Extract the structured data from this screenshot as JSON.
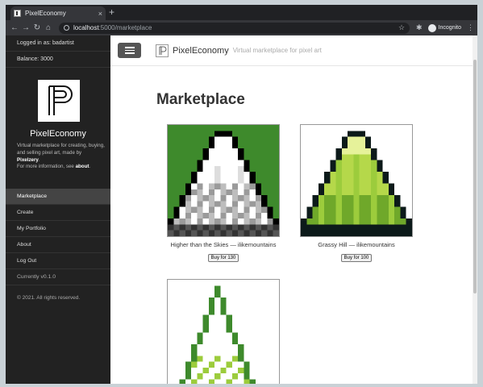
{
  "browser": {
    "tab_title": "PixelEconomy",
    "tab_close": "×",
    "new_tab": "+",
    "url_host": "localhost",
    "url_path": ":5000/marketplace",
    "incognito_label": "Incognito"
  },
  "sidebar": {
    "logged_in": "Logged in as: badartist",
    "balance": "Balance: 3000",
    "brand": "PixelEconomy",
    "desc_1": "Virtual marketplace for creating, buying, and selling pixel art, made by ",
    "desc_author": "Pixelzery",
    "desc_2": ".",
    "desc_more": "For more information, see ",
    "desc_about": "about",
    "desc_end": ".",
    "nav": [
      {
        "label": "Marketplace",
        "active": true
      },
      {
        "label": "Create"
      },
      {
        "label": "My Portfolio"
      },
      {
        "label": "About"
      },
      {
        "label": "Log Out"
      }
    ],
    "version": "Currently v0.1.0",
    "copyright": "© 2021. All rights reserved."
  },
  "topbar": {
    "brand": "PixelEconomy",
    "tagline": "Virtual marketplace for pixel art"
  },
  "main": {
    "title": "Marketplace",
    "listings": [
      {
        "label": "Higher than the Skies — ilikemountains",
        "buy": "Buy for 130"
      },
      {
        "label": "Grassy Hill — ilikemountains",
        "buy": "Buy for 100"
      },
      {
        "label": "",
        "buy": ""
      }
    ]
  },
  "colors": {
    "sidebar_bg": "#222222",
    "grass_green": "#3e8a2c",
    "lime": "#9ccc3c",
    "dark": "#0c1a1a"
  }
}
